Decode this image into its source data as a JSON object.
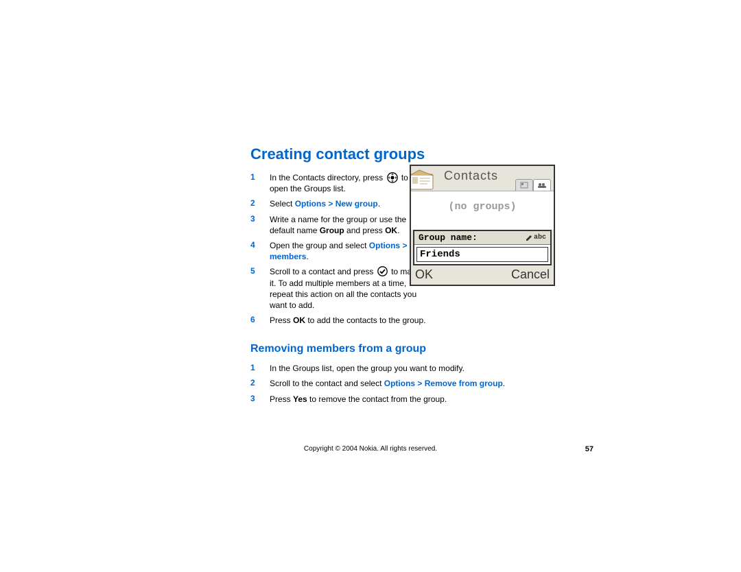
{
  "heading1": "Creating contact groups",
  "stepsA": [
    {
      "n": "1",
      "parts": [
        {
          "t": "In the Contacts directory, press "
        },
        {
          "icon": "joy"
        },
        {
          "t": " to open the Groups list."
        }
      ]
    },
    {
      "n": "2",
      "parts": [
        {
          "t": "Select "
        },
        {
          "opt": "Options > New group"
        },
        {
          "t": "."
        }
      ]
    },
    {
      "n": "3",
      "parts": [
        {
          "t": "Write a name for the group or use the default name "
        },
        {
          "kb": "Group"
        },
        {
          "t": " and press "
        },
        {
          "kb": "OK"
        },
        {
          "t": "."
        }
      ]
    },
    {
      "n": "4",
      "parts": [
        {
          "t": "Open the group and select "
        },
        {
          "opt": "Options > Add members"
        },
        {
          "t": "."
        }
      ]
    },
    {
      "n": "5",
      "parts": [
        {
          "t": "Scroll to a contact and press "
        },
        {
          "icon": "check"
        },
        {
          "t": " to mark it. To add multiple members at a time, repeat this action on all the contacts you want to add."
        }
      ]
    },
    {
      "n": "6",
      "wide": true,
      "parts": [
        {
          "t": "Press "
        },
        {
          "kb": "OK"
        },
        {
          "t": " to add the contacts to the group."
        }
      ]
    }
  ],
  "heading2": "Removing members from a group",
  "stepsB": [
    {
      "n": "1",
      "wide": true,
      "parts": [
        {
          "t": "In the Groups list, open the group you want to modify."
        }
      ]
    },
    {
      "n": "2",
      "wide": true,
      "parts": [
        {
          "t": "Scroll to the contact and select "
        },
        {
          "opt": "Options > Remove from group"
        },
        {
          "t": "."
        }
      ]
    },
    {
      "n": "3",
      "wide": true,
      "parts": [
        {
          "t": "Press "
        },
        {
          "kb": "Yes"
        },
        {
          "t": " to remove the contact from the group."
        }
      ]
    }
  ],
  "phone": {
    "title": "Contacts",
    "noGroups": "(no groups)",
    "popupLabel": "Group name:",
    "mode": "abc",
    "input": "Friends",
    "softLeft": "OK",
    "softRight": "Cancel"
  },
  "footer": "Copyright © 2004 Nokia. All rights reserved.",
  "pageNumber": "57"
}
